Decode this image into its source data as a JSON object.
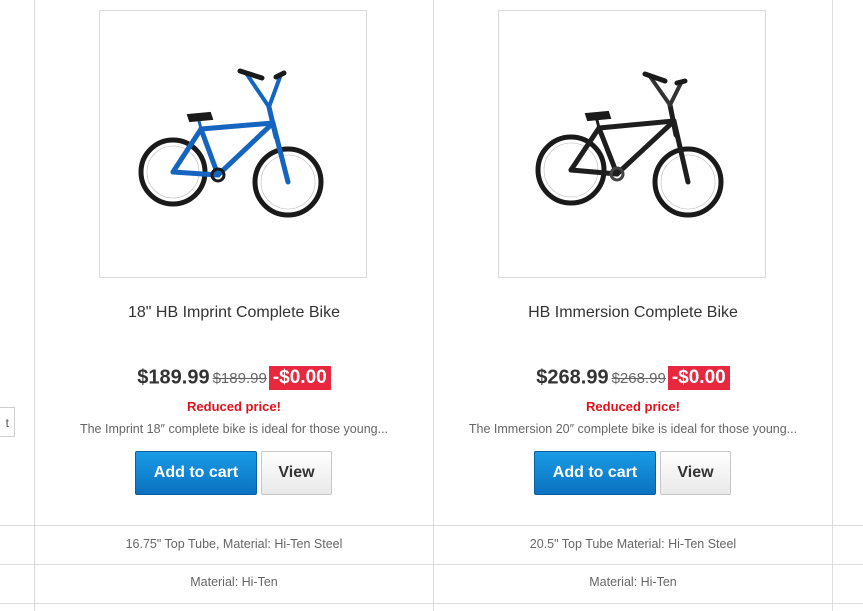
{
  "side": {
    "button_label": "t"
  },
  "products": [
    {
      "name": "18\" HB Imprint Complete Bike",
      "price": "$189.99",
      "old_price": "$189.99",
      "discount": "-$0.00",
      "reduced_label": "Reduced price!",
      "description": "The Imprint 18″ complete bike is ideal for those young...",
      "add_to_cart": "Add to cart",
      "view": "View",
      "spec_1": "16.75\" Top Tube, Material: Hi-Ten Steel",
      "spec_2": "Material: Hi-Ten",
      "bike_color": "#1565c0"
    },
    {
      "name": "HB Immersion Complete Bike",
      "price": "$268.99",
      "old_price": "$268.99",
      "discount": "-$0.00",
      "reduced_label": "Reduced price!",
      "description": "The Immersion 20″ complete bike is ideal for those young...",
      "add_to_cart": "Add to cart",
      "view": "View",
      "spec_1": "20.5\" Top Tube Material: Hi-Ten Steel",
      "spec_2": "Material: Hi-Ten",
      "bike_color": "#1e1e1e"
    }
  ]
}
